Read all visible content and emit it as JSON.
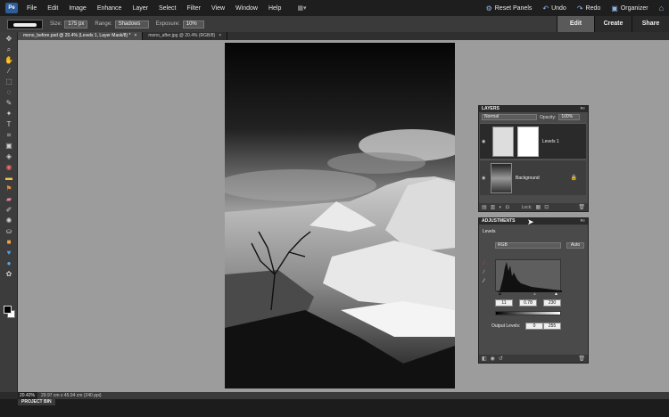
{
  "menu": [
    "File",
    "Edit",
    "Image",
    "Enhance",
    "Layer",
    "Select",
    "Filter",
    "View",
    "Window",
    "Help"
  ],
  "topright": {
    "reset_panels": "Reset Panels",
    "undo": "Undo",
    "redo": "Redo",
    "organizer": "Organizer"
  },
  "options": {
    "size_label": "Size:",
    "size_value": "175 px",
    "range_label": "Range:",
    "range_value": "Shadows",
    "exposure_label": "Exposure:",
    "exposure_value": "10%"
  },
  "modes": {
    "edit": "Edit",
    "create": "Create",
    "share": "Share"
  },
  "tabs": [
    {
      "label": "mono_before.psd @ 20.4% (Levels 1, Layer Mask/8) *",
      "close": "×"
    },
    {
      "label": "mono_after.jpg @ 20.4% (RGB/8)",
      "close": "×"
    }
  ],
  "status": {
    "zoom": "20.42%",
    "doc": "29.97 cm x 45.04 cm (240 ppi)"
  },
  "project_bin": "PROJECT BIN",
  "layers": {
    "title": "LAYERS",
    "blend_mode": "Normal",
    "opacity_label": "Opacity:",
    "opacity_value": "100%",
    "items": [
      {
        "name": "Levels 1"
      },
      {
        "name": "Background"
      }
    ],
    "lock_label": "Lock:"
  },
  "adjustments": {
    "title": "ADJUSTMENTS",
    "type": "Levels",
    "channel": "RGB",
    "auto": "Auto",
    "input_black": "11",
    "input_gamma": "0.78",
    "input_white": "230",
    "output_label": "Output Levels:",
    "output_black": "0",
    "output_white": "255"
  }
}
